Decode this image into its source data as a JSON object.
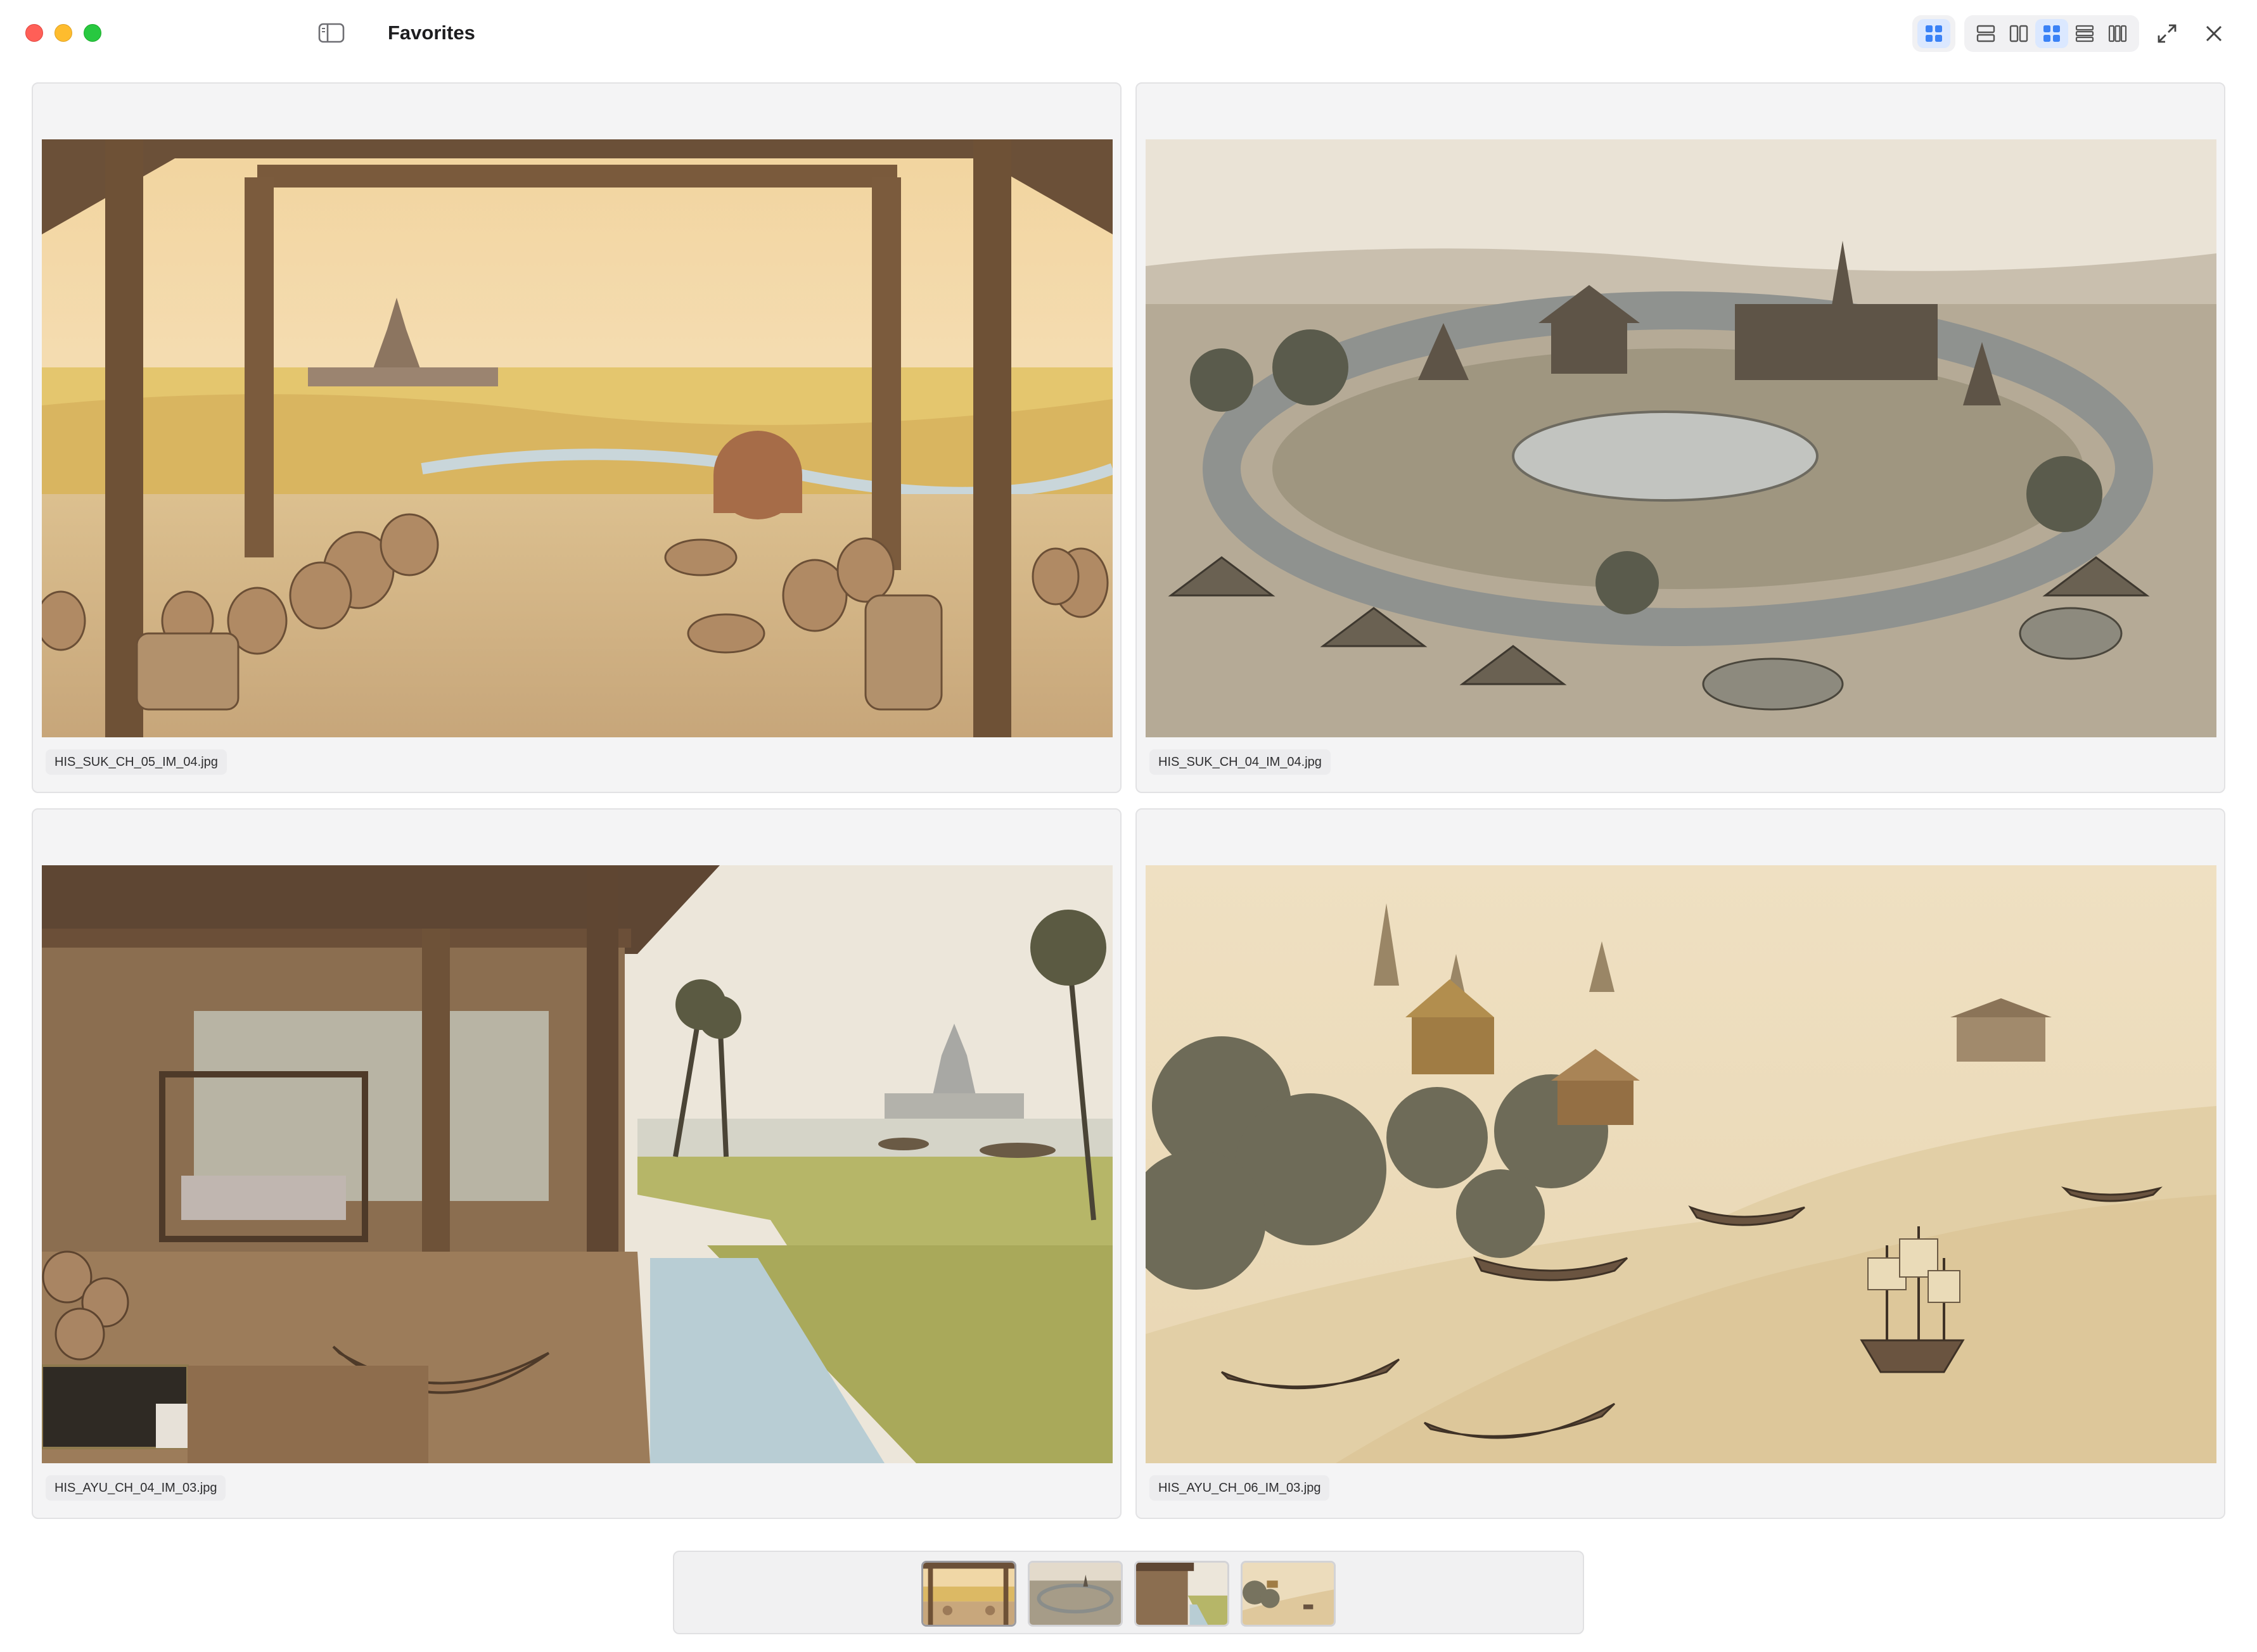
{
  "window": {
    "title": "Favorites"
  },
  "toolbar": {
    "layout_buttons": [
      {
        "icon": "grid-2x2-icon",
        "active": true
      },
      {
        "icon": "rows-icon",
        "active": false
      },
      {
        "icon": "columns-icon",
        "active": false
      },
      {
        "icon": "grid-2x2-icon",
        "active": true
      },
      {
        "icon": "list-icon",
        "active": false
      },
      {
        "icon": "three-columns-icon",
        "active": false
      }
    ],
    "fullscreen_icon": "expand-arrows-icon",
    "close_icon": "close-icon",
    "accent_color": "#3b82f6"
  },
  "gallery": {
    "items": [
      {
        "filename": "HIS_SUK_CH_05_IM_04.jpg"
      },
      {
        "filename": "HIS_SUK_CH_04_IM_04.jpg"
      },
      {
        "filename": "HIS_AYU_CH_04_IM_03.jpg"
      },
      {
        "filename": "HIS_AYU_CH_06_IM_03.jpg"
      }
    ]
  },
  "filmstrip": {
    "count": 4
  }
}
